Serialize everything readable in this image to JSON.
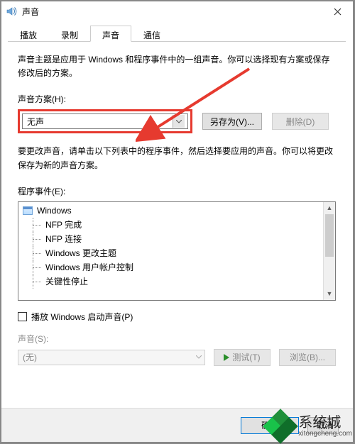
{
  "window": {
    "title": "声音"
  },
  "tabs": {
    "items": [
      {
        "label": "播放"
      },
      {
        "label": "录制"
      },
      {
        "label": "声音"
      },
      {
        "label": "通信"
      }
    ],
    "active_index": 2
  },
  "theme_desc": "声音主题是应用于 Windows 和程序事件中的一组声音。你可以选择现有方案或保存修改后的方案。",
  "scheme": {
    "label": "声音方案(H):",
    "value": "无声",
    "save_as_label": "另存为(V)...",
    "delete_label": "删除(D)"
  },
  "change_desc": "要更改声音，请单击以下列表中的程序事件，然后选择要应用的声音。你可以将更改保存为新的声音方案。",
  "events": {
    "label": "程序事件(E):",
    "root": "Windows",
    "items": [
      "NFP 完成",
      "NFP 连接",
      "Windows 更改主题",
      "Windows 用户帐户控制",
      "关键性停止"
    ]
  },
  "play_startup": {
    "label": "播放 Windows 启动声音(P)",
    "checked": false
  },
  "sound": {
    "label": "声音(S):",
    "value": "(无)",
    "test_label": "测试(T)",
    "browse_label": "浏览(B)..."
  },
  "footer": {
    "ok": "确定",
    "cancel": "取消"
  },
  "watermark": {
    "text": "系统城",
    "url": "xitongcheng.com"
  }
}
